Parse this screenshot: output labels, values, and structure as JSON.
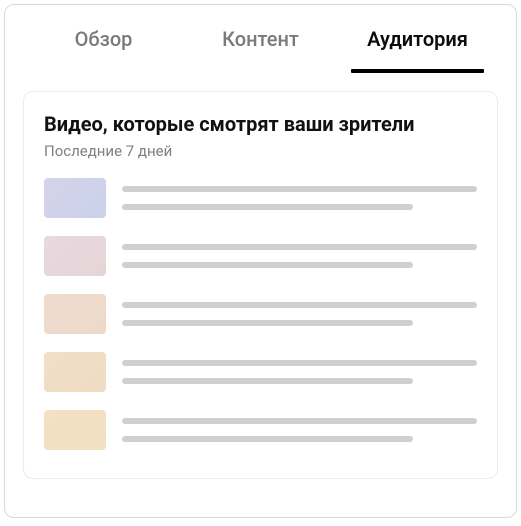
{
  "tabs": [
    {
      "label": "Обзор",
      "active": false
    },
    {
      "label": "Контент",
      "active": false
    },
    {
      "label": "Аудитория",
      "active": true
    }
  ],
  "card": {
    "title": "Видео, которые смотрят ваши зрители",
    "subtitle": "Последние 7 дней",
    "rows": [
      {
        "thumb_class": "t0"
      },
      {
        "thumb_class": "t1"
      },
      {
        "thumb_class": "t2"
      },
      {
        "thumb_class": "t3"
      },
      {
        "thumb_class": "t4"
      }
    ]
  }
}
